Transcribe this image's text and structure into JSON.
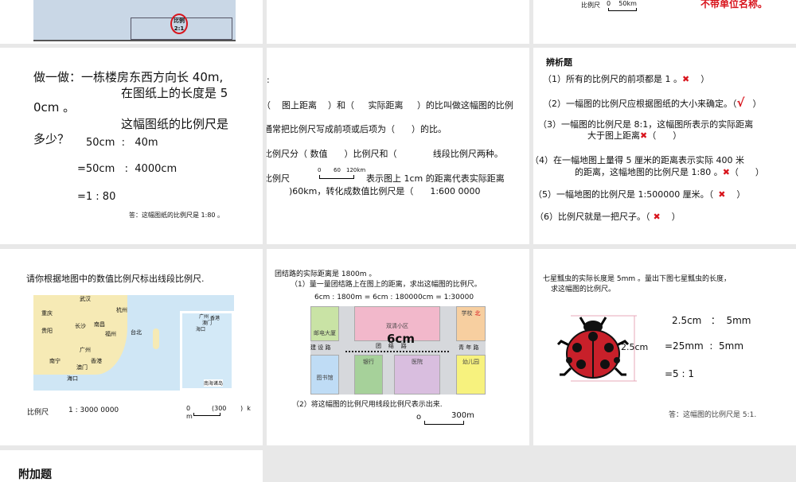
{
  "slides": [
    {
      "drawing_stamp": "比例",
      "drawing_stamp_ratio": "2:1"
    },
    {},
    {
      "scale_label": "比例尺",
      "scale_ticks": "0    50km",
      "note": "不带单位名称。"
    },
    {
      "lines": [
        "做一做：一栋楼房东西方向长 40m,",
        "在图纸上的长度是 5",
        "0cm 。",
        "这幅图纸的比例尺是",
        "多少？"
      ],
      "steps": [
        "50cm  :   40m",
        "=50cm   :  4000cm",
        "=1 : 80"
      ],
      "answer": "答：这幅图纸的比例尺是 1:80 。"
    },
    {
      "lines": [
        ":",
        "（    图上距离    ）和（     实际距离     ）的比叫做这幅图的比例",
        "通常把比例尺写成前项或后项为（      ）的比。",
        "比例尺分（ 数值      ）比例尺和（             线段比例尺两种。",
        "比例尺",
        "表示图上 1cm 的距离代表实际距离",
        ")60km，转化成数值比例尺是（      1:600 0000"
      ],
      "scale_ticks": [
        "0",
        "60",
        "120km"
      ]
    },
    {
      "title": "辨析题",
      "items": [
        {
          "text": "（1）所有的比例尺的前项都是 1 。",
          "mark": "✖",
          "close": "）"
        },
        {
          "text": "（2）一幅图的比例尺应根据图纸的大小来确定。（",
          "mark": "√",
          "close": "）"
        },
        {
          "text": "（3）一幅图的比例尺是 8:1，这幅图所表示的实际距离",
          "text2": "大于图上距离",
          "mark": "✖",
          "close": "（      ）"
        },
        {
          "text": "（4）在一幅地图上量得 5 厘米的距离表示实际 400 米",
          "text2": "的距离，这幅地图的比例尺是 1:80 。",
          "mark": "✖",
          "close": "（      ）"
        },
        {
          "text": "（5）一幅地图的比例尺是 1:500000 厘米。（",
          "mark": "✖",
          "close": "）"
        },
        {
          "text": "（6）比例尺就是一把尺子。（",
          "mark": "✖",
          "close": "）"
        }
      ]
    },
    {
      "title": "请你根据地图中的数值比例尺标出线段比例尺.",
      "cities": [
        "武汉",
        "杭州",
        "重庆",
        "长沙",
        "南昌",
        "贵阳",
        "福州",
        "台北",
        "广州",
        "南宁",
        "香港",
        "澳门",
        "海口"
      ],
      "inset_cities": [
        "广州",
        "香港",
        "澳门",
        "海口"
      ],
      "inset_label": "南海诸岛",
      "scale_label": "比例尺",
      "scale_value": "1 : 3000 0000",
      "scale_zero": "0",
      "scale_unit_m": "m",
      "scale_mark": "(300",
      "scale_close": ")  k"
    },
    {
      "title": "团结路的实际距离是 1800m 。",
      "q1": "（1）量一量团结路上在图上的距离，求出这幅图的比例尺。",
      "calc": "6cm : 1800m = 6cm : 180000cm = 1:30000",
      "map": {
        "measure": "6cm",
        "road_main": "团    结    路",
        "road_left": "建 设 路",
        "road_right": "青 年 路",
        "blocks": [
          "邮电大厦",
          "双清小区",
          "学校",
          "北",
          "图书馆",
          "银行",
          "医院",
          "幼儿园"
        ]
      },
      "q2": "（2）将这幅图的比例尺用线段比例尺表示出来.",
      "scale_zero": "o",
      "scale_value": "300m"
    },
    {
      "title": "七星瓢虫的实际长度是 5mm 。量出下图七星瓢虫的长度，",
      "title2": "求这幅图的比例尺。",
      "measure": "2.5cm",
      "steps": [
        "2.5cm   ：  5mm",
        "=25mm  :  5mm",
        "=5 : 1"
      ],
      "answer": "答：这幅图的比例尺是 5:1."
    },
    {
      "title": "附加题"
    }
  ]
}
